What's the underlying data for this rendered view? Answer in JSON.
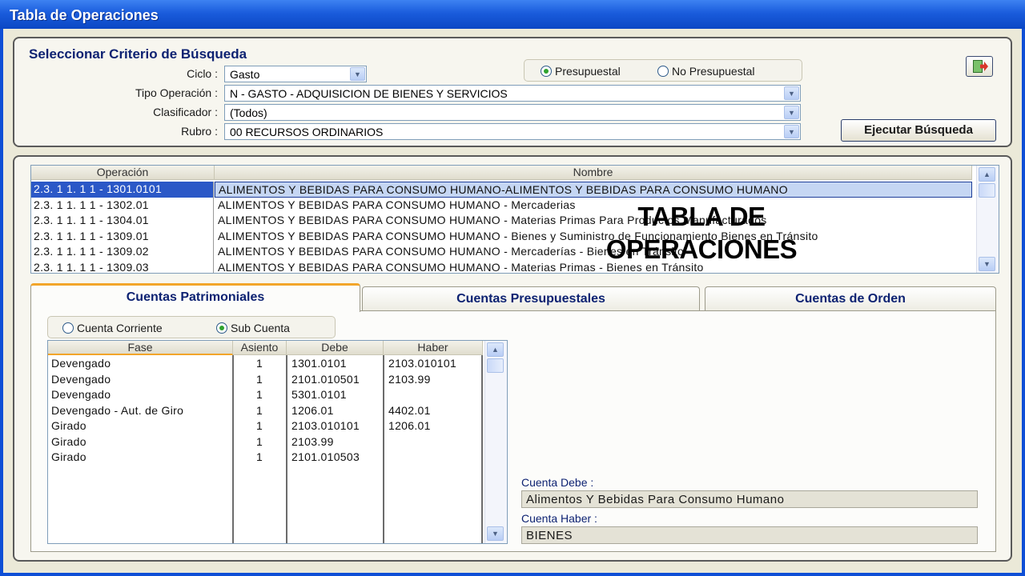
{
  "window": {
    "title": "Tabla de Operaciones"
  },
  "search": {
    "title": "Seleccionar Criterio de Búsqueda",
    "fields": {
      "ciclo": {
        "label": "Ciclo :",
        "value": "Gasto"
      },
      "tipo_operacion": {
        "label": "Tipo Operación :",
        "value": "N  - GASTO - ADQUISICION DE BIENES Y SERVICIOS"
      },
      "clasificador": {
        "label": "Clasificador :",
        "value": "(Todos)"
      },
      "rubro": {
        "label": "Rubro :",
        "value": "00 RECURSOS ORDINARIOS"
      }
    },
    "presupuestal_options": [
      {
        "label": "Presupuestal",
        "selected": true
      },
      {
        "label": "No Presupuestal",
        "selected": false
      }
    ],
    "execute_label": "Ejecutar Búsqueda",
    "export_icon": "export-excel-icon"
  },
  "operations": {
    "columns": [
      "Operación",
      "Nombre"
    ],
    "rows": [
      {
        "operacion": "2.3. 1 1. 1 1 - 1301.0101",
        "nombre": "ALIMENTOS Y BEBIDAS PARA CONSUMO HUMANO-ALIMENTOS Y BEBIDAS PARA CONSUMO HUMANO",
        "selected": true
      },
      {
        "operacion": "2.3. 1 1. 1 1 - 1302.01",
        "nombre": "ALIMENTOS Y BEBIDAS PARA CONSUMO HUMANO - Mercaderias",
        "selected": false
      },
      {
        "operacion": "2.3. 1 1. 1 1 - 1304.01",
        "nombre": "ALIMENTOS Y BEBIDAS PARA CONSUMO HUMANO - Materias Primas Para Productos Manufacturados",
        "selected": false
      },
      {
        "operacion": "2.3. 1 1. 1 1 - 1309.01",
        "nombre": "ALIMENTOS Y BEBIDAS PARA CONSUMO HUMANO - Bienes y Suministro de Funcionamiento Bienes en Tránsito",
        "selected": false
      },
      {
        "operacion": "2.3. 1 1. 1 1 - 1309.02",
        "nombre": "ALIMENTOS Y BEBIDAS PARA CONSUMO HUMANO - Mercaderías - Bienes en Tránsito",
        "selected": false
      },
      {
        "operacion": "2.3. 1 1. 1 1 - 1309.03",
        "nombre": "ALIMENTOS Y BEBIDAS PARA CONSUMO HUMANO - Materias Primas - Bienes en Tránsito",
        "selected": false
      }
    ]
  },
  "tabs": [
    {
      "label": "Cuentas Patrimoniales",
      "active": true
    },
    {
      "label": "Cuentas Presupuestales",
      "active": false
    },
    {
      "label": "Cuentas de Orden",
      "active": false
    }
  ],
  "cuenta_options": [
    {
      "label": "Cuenta Corriente",
      "selected": false
    },
    {
      "label": "Sub Cuenta",
      "selected": true
    }
  ],
  "asientos": {
    "columns": [
      "Fase",
      "Asiento",
      "Debe",
      "Haber"
    ],
    "rows": [
      {
        "fase": "Devengado",
        "asiento": "1",
        "debe": "1301.0101",
        "haber": "2103.010101"
      },
      {
        "fase": "Devengado",
        "asiento": "1",
        "debe": "2101.010501",
        "haber": "2103.99"
      },
      {
        "fase": "Devengado",
        "asiento": "1",
        "debe": "5301.0101",
        "haber": ""
      },
      {
        "fase": "Devengado - Aut. de Giro",
        "asiento": "1",
        "debe": "1206.01",
        "haber": "4402.01"
      },
      {
        "fase": "Girado",
        "asiento": "1",
        "debe": "2103.010101",
        "haber": "1206.01"
      },
      {
        "fase": "Girado",
        "asiento": "1",
        "debe": "2103.99",
        "haber": ""
      },
      {
        "fase": "Girado",
        "asiento": "1",
        "debe": "2101.010503",
        "haber": ""
      }
    ]
  },
  "overlay_title": [
    "TABLA DE",
    "OPERACIONES"
  ],
  "detail": {
    "cuenta_debe_label": "Cuenta Debe :",
    "cuenta_debe_value": "Alimentos Y Bebidas Para Consumo Humano",
    "cuenta_haber_label": "Cuenta Haber :",
    "cuenta_haber_value": "BIENES"
  },
  "colors": {
    "title_bar": "#1a5cdc",
    "selection": "#2b58c7",
    "heading_text": "#0d2272",
    "active_tab_accent": "#f2a52a"
  }
}
